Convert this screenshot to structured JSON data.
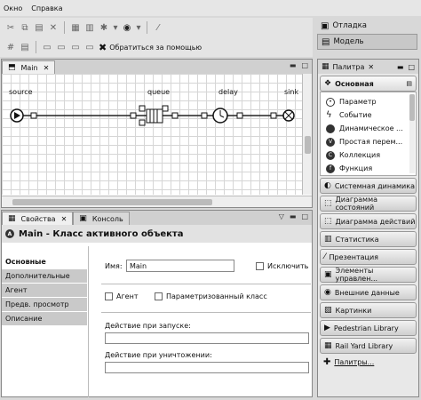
{
  "menu": [
    "Окно",
    "Справка"
  ],
  "toolbar": {
    "help_label": "Обратиться за помощью"
  },
  "perspectives": [
    {
      "label": "Отладка",
      "icon": "bug-icon",
      "active": false
    },
    {
      "label": "Модель",
      "icon": "model-icon",
      "active": true
    }
  ],
  "editor": {
    "tab_label": "Main",
    "blocks": [
      "source",
      "queue",
      "delay",
      "sink"
    ]
  },
  "bottom": {
    "tabs": [
      {
        "label": "Свойства",
        "icon": "properties-icon"
      },
      {
        "label": "Консоль",
        "icon": "console-icon"
      }
    ],
    "title": "Main - Класс активного объекта",
    "side_tabs": [
      "Основные",
      "Дополнительные",
      "Агент",
      "Предв. просмотр",
      "Описание"
    ],
    "form": {
      "name_label": "Имя:",
      "name_value": "Main",
      "exclude_label": "Исключить",
      "agent_label": "Агент",
      "param_label": "Параметризованный класс",
      "startup_label": "Действие при запуске:",
      "destroy_label": "Действие при уничтожении:"
    }
  },
  "palette": {
    "tab_label": "Палитра",
    "open_section": "Основная",
    "items": [
      {
        "label": "Параметр",
        "icon": "parameter-icon"
      },
      {
        "label": "Событие",
        "icon": "event-icon"
      },
      {
        "label": "Динамическое ...",
        "icon": "dynamic-variable-icon"
      },
      {
        "label": "Простая перем...",
        "icon": "variable-icon"
      },
      {
        "label": "Коллекция",
        "icon": "collection-icon"
      },
      {
        "label": "Функция",
        "icon": "function-icon"
      }
    ],
    "sections": [
      "Системная динамика",
      "Диаграмма состояний",
      "Диаграмма действий",
      "Статистика",
      "Презентация",
      "Элементы управлен...",
      "Внешние данные",
      "Картинки",
      "Pedestrian Library",
      "Rail Yard Library"
    ],
    "more_label": "Палитры..."
  }
}
